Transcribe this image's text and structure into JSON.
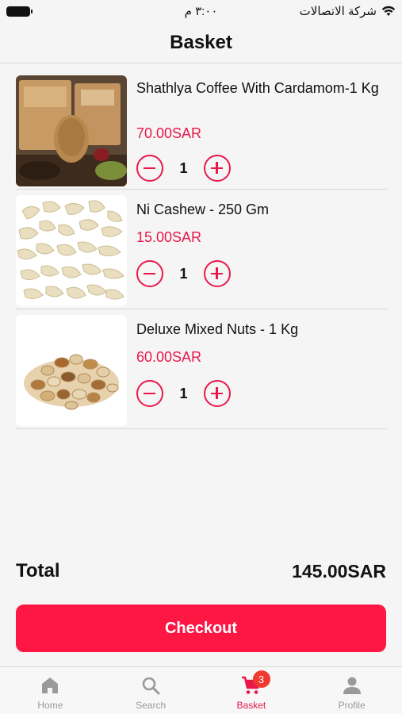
{
  "status_bar": {
    "time": "٣:٠٠ م",
    "carrier": "شركة الاتصالات"
  },
  "header": {
    "title": "Basket"
  },
  "basket": {
    "items": [
      {
        "name": "Shathlya Coffee With Cardamom-1 Kg",
        "price": "70.00SAR",
        "quantity": "1",
        "image": "coffee-cardamom-bags"
      },
      {
        "name": "Ni Cashew - 250 Gm",
        "price": "15.00SAR",
        "quantity": "1",
        "image": "cashew-nuts"
      },
      {
        "name": "Deluxe Mixed Nuts - 1 Kg",
        "price": "60.00SAR",
        "quantity": "1",
        "image": "mixed-nuts"
      }
    ]
  },
  "summary": {
    "total_label": "Total",
    "total_value": "145.00SAR"
  },
  "checkout": {
    "label": "Checkout"
  },
  "bottom_nav": {
    "items": [
      {
        "label": "Home",
        "icon": "home-icon",
        "active": false
      },
      {
        "label": "Search",
        "icon": "search-icon",
        "active": false
      },
      {
        "label": "Basket",
        "icon": "cart-icon",
        "active": true,
        "badge": "3"
      },
      {
        "label": "Profile",
        "icon": "profile-icon",
        "active": false
      }
    ]
  },
  "colors": {
    "accent": "#e8194a",
    "checkout": "#ff1744",
    "badge": "#f03a2f",
    "nav_inactive": "#9a9a9a"
  }
}
